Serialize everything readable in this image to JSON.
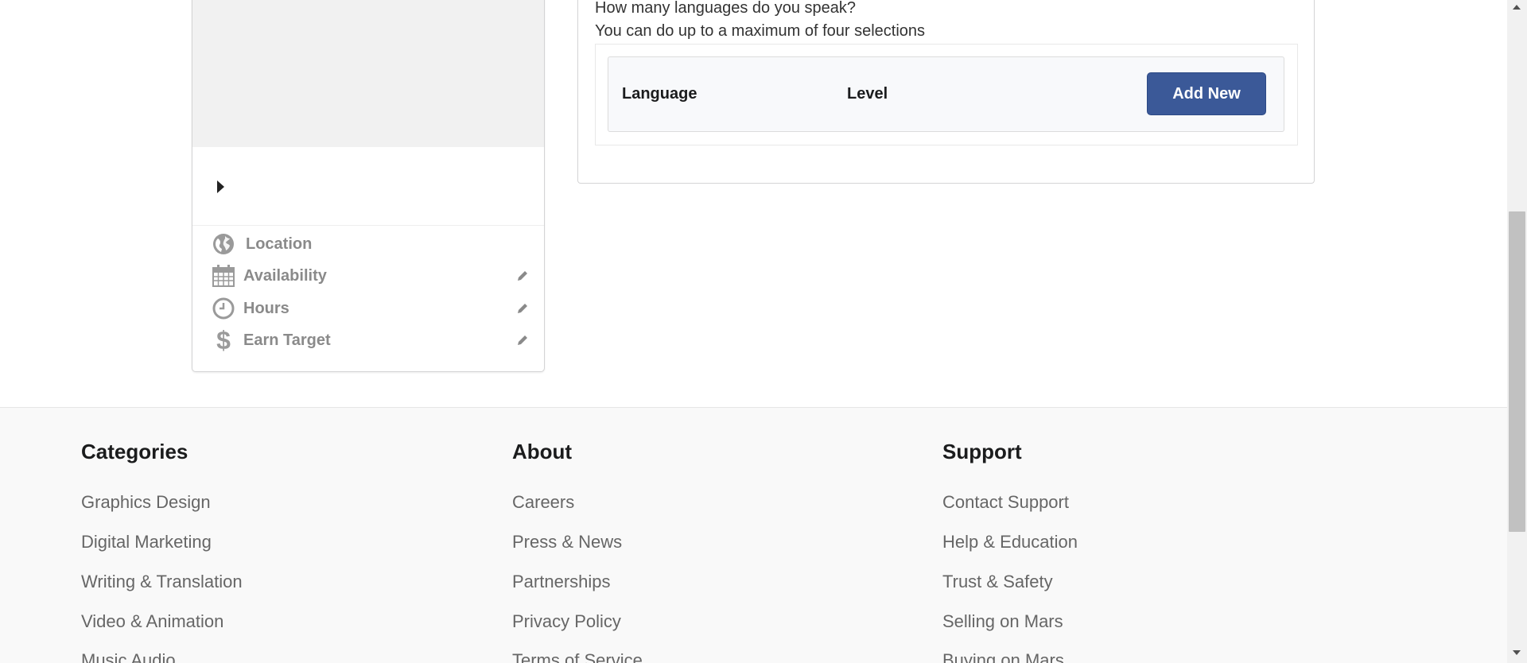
{
  "sidebar": {
    "items": [
      {
        "label": "Location",
        "icon": "globe-icon",
        "editable": false
      },
      {
        "label": "Availability",
        "icon": "calendar-icon",
        "editable": true
      },
      {
        "label": "Hours",
        "icon": "clock-icon",
        "editable": true
      },
      {
        "label": "Earn Target",
        "icon": "dollar-icon",
        "editable": true
      }
    ]
  },
  "languages": {
    "question": "How many languages do you speak?",
    "hint": "You can do up to a maximum of four selections",
    "col_language": "Language",
    "col_level": "Level",
    "add_label": "Add New",
    "accent": "#3b5998"
  },
  "footer": {
    "columns": [
      {
        "title": "Categories",
        "links": [
          "Graphics Design",
          "Digital Marketing",
          "Writing & Translation",
          "Video & Animation",
          "Music Audio"
        ]
      },
      {
        "title": "About",
        "links": [
          "Careers",
          "Press & News",
          "Partnerships",
          "Privacy Policy",
          "Terms of Service"
        ]
      },
      {
        "title": "Support",
        "links": [
          "Contact Support",
          "Help & Education",
          "Trust & Safety",
          "Selling on Mars",
          "Buying on Mars"
        ]
      }
    ]
  }
}
